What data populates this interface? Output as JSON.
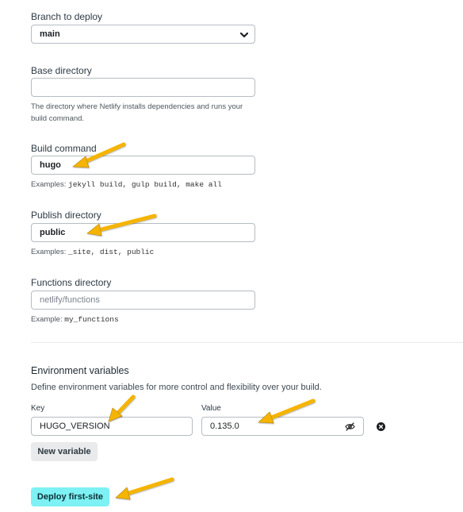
{
  "branch": {
    "label": "Branch to deploy",
    "value": "main"
  },
  "base_directory": {
    "label": "Base directory",
    "value": "",
    "help_line1": "The directory where Netlify installs dependencies and runs your",
    "help_line2": "build command."
  },
  "build_command": {
    "label": "Build command",
    "value": "hugo",
    "examples_prefix": "Examples: ",
    "examples": "jekyll build, gulp build, make all"
  },
  "publish_directory": {
    "label": "Publish directory",
    "value": "public",
    "examples_prefix": "Examples: ",
    "examples": "_site, dist, public"
  },
  "functions_directory": {
    "label": "Functions directory",
    "placeholder": "netlify/functions",
    "example_prefix": "Example: ",
    "example": "my_functions"
  },
  "env": {
    "title": "Environment variables",
    "description": "Define environment variables for more control and flexibility over your build.",
    "key_label": "Key",
    "value_label": "Value",
    "key": "HUGO_VERSION",
    "value": "0.135.0",
    "new_variable_label": "New variable"
  },
  "deploy": {
    "label": "Deploy first-site"
  },
  "colors": {
    "annotation_arrow": "#f5b400",
    "deploy_button": "#7df1f3"
  },
  "icons": [
    "chevron-down-icon",
    "eye-off-icon",
    "remove-circle-icon",
    "annotation-arrow"
  ]
}
